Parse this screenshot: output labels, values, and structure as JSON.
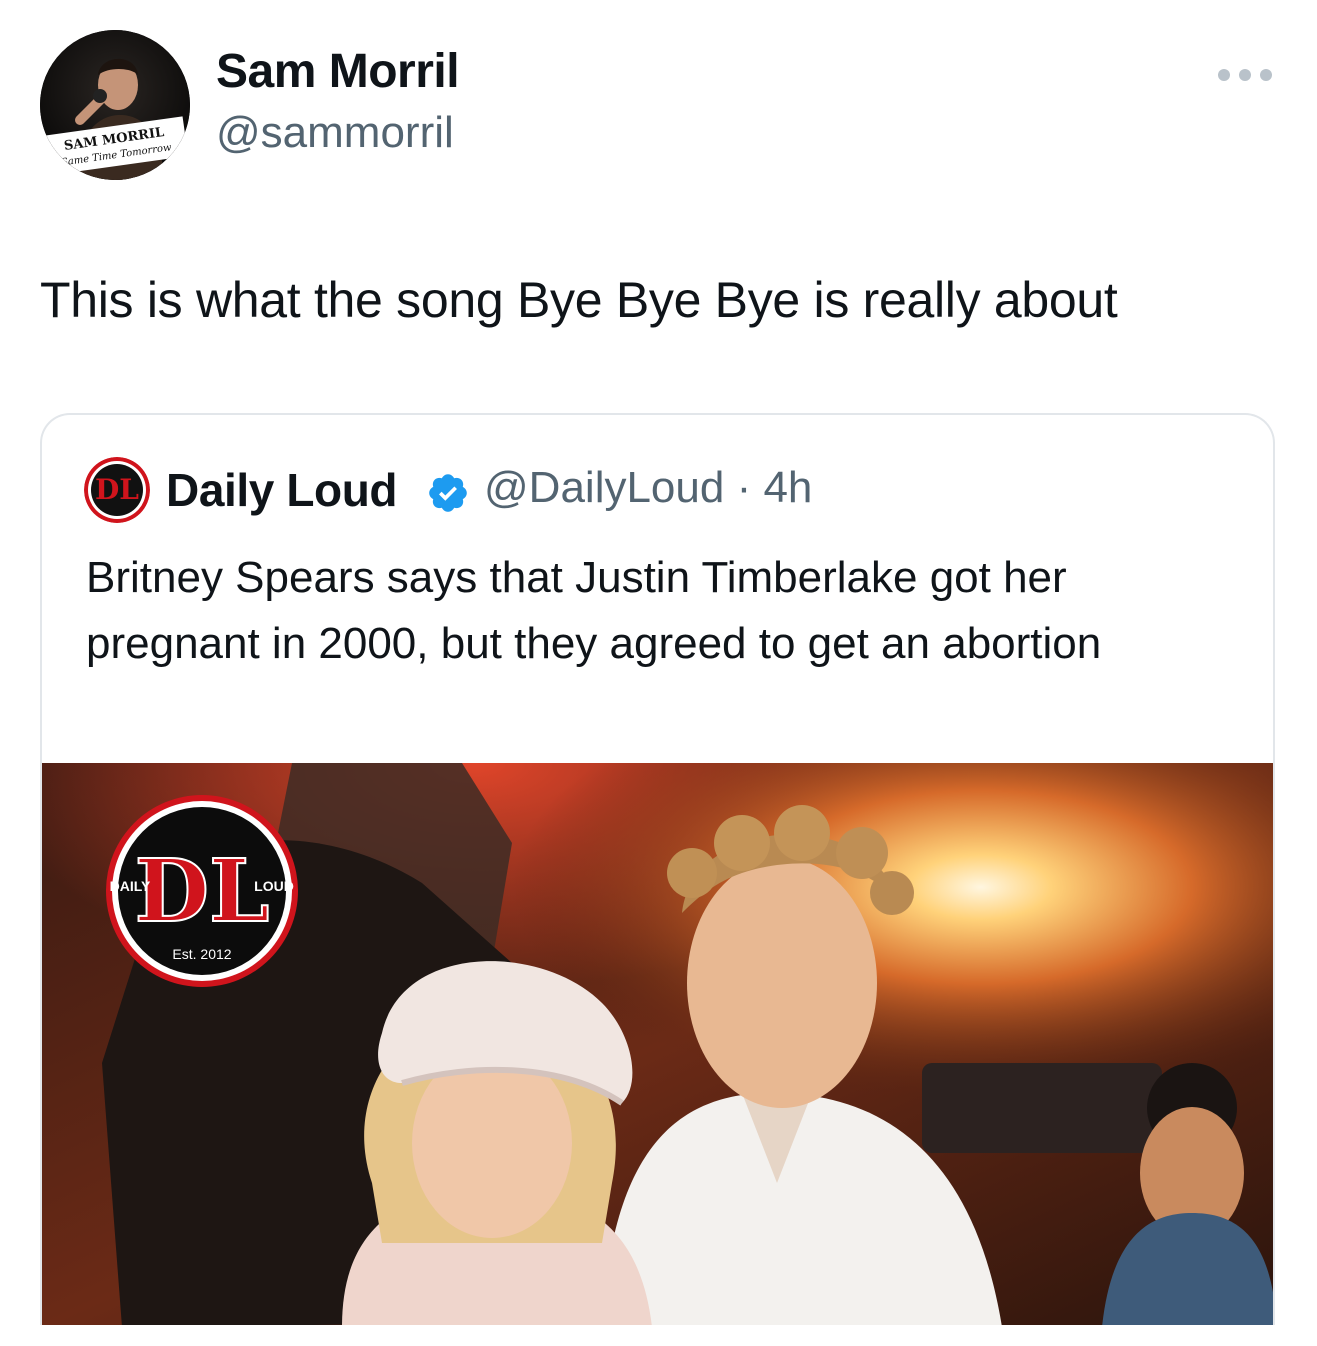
{
  "tweet": {
    "author_name": "Sam Morril",
    "author_handle": "@sammorril",
    "avatar_text_line1": "SAM MORRIL",
    "avatar_text_line2": "Same Time Tomorrow",
    "text": "This is what the song Bye Bye Bye is really about",
    "more_icon": "more-horizontal-icon"
  },
  "quoted": {
    "name": "Daily Loud",
    "handle_time": "@DailyLoud · 4h",
    "text": "Britney Spears says that Justin Timberlake got her pregnant in 2000, but they agreed to get an abortion",
    "verified_icon": "verified-badge-icon",
    "logo": {
      "left": "DAILY",
      "right": "LOUD",
      "est": "Est. 2012",
      "mark": "DL"
    }
  },
  "colors": {
    "text": "#0f1419",
    "secondary": "#536471",
    "verified": "#1d9bf0",
    "logo_red": "#d0141c"
  }
}
